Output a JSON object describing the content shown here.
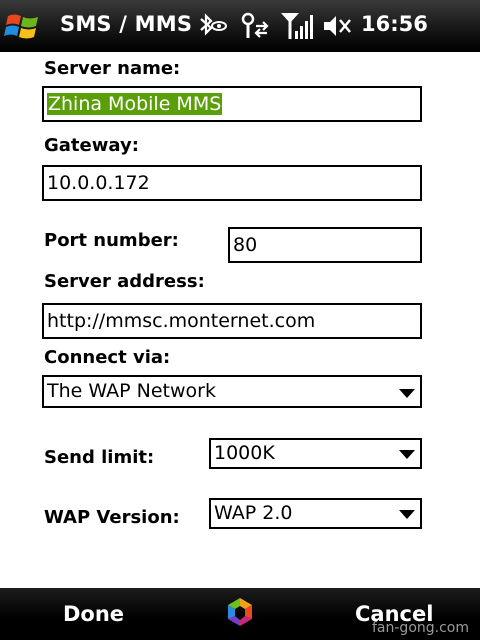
{
  "titlebar": {
    "title": "SMS / MMS",
    "time": "16:56",
    "icons": [
      "windows-start-icon",
      "bluetooth-icon",
      "connectivity-icon",
      "signal-icon",
      "volume-muted-icon"
    ]
  },
  "form": {
    "server_name": {
      "label": "Server name:",
      "value": "Zhina Mobile MMS"
    },
    "gateway": {
      "label": "Gateway:",
      "value": "10.0.0.172"
    },
    "port_number": {
      "label": "Port number:",
      "value": "80"
    },
    "server_address": {
      "label": "Server address:",
      "value": "http://mmsc.monternet.com"
    },
    "connect_via": {
      "label": "Connect via:",
      "value": "The WAP Network"
    },
    "send_limit": {
      "label": "Send limit:",
      "value": "1000K"
    },
    "wap_version": {
      "label": "WAP Version:",
      "value": "WAP 2.0"
    }
  },
  "softkeys": {
    "left": "Done",
    "right": "Cancel",
    "center_icon": "color-wheel-icon"
  },
  "watermark": "fan-gong.com"
}
